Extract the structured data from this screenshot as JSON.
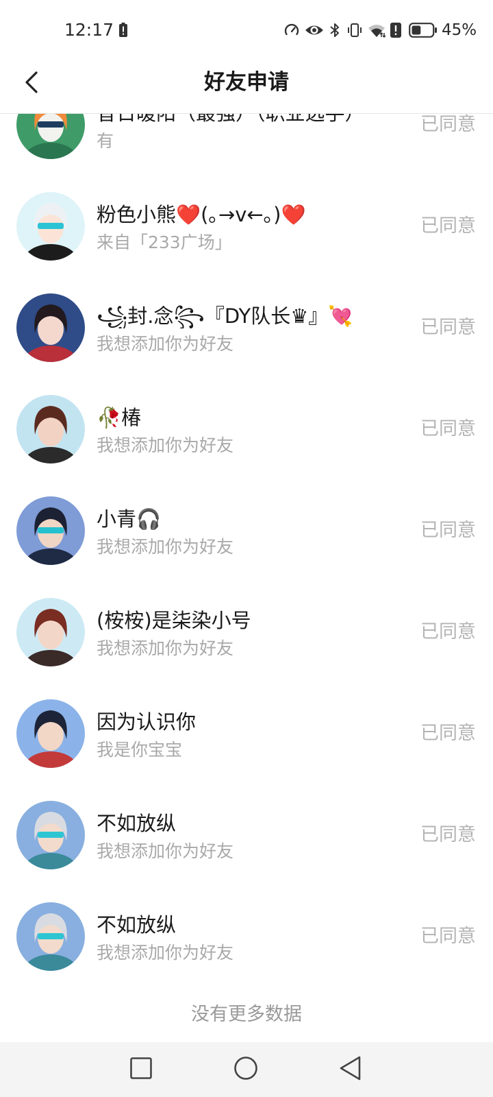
{
  "status_bar": {
    "time": "12:17",
    "battery_text": "45%",
    "battery_level": 0.45,
    "icons": [
      "battery-alert-icon",
      "speedometer-icon",
      "eye-icon",
      "bluetooth-icon",
      "vibrate-icon",
      "wifi-icon",
      "alert-icon",
      "battery-icon"
    ]
  },
  "header": {
    "back_icon": "back-arrow-icon",
    "title": "好友申请"
  },
  "requests": [
    {
      "name": "昔日暖阳（最强）（职业选手）",
      "message": "有",
      "status": "已同意",
      "avatar": {
        "bg": "#3f9c68",
        "hair": "#ef8b3b",
        "skin": "#f2f2ef",
        "outfit": "#2a7650",
        "accent": "#1f3d5e"
      }
    },
    {
      "name": "粉色小熊❤️(｡→v←｡)❤️",
      "message": "来自「233广场」",
      "status": "已同意",
      "avatar": {
        "bg": "#dff4f8",
        "hair": "#eef1f4",
        "skin": "#fbe4d7",
        "outfit": "#1c1c1c",
        "accent": "#2cc3d5"
      }
    },
    {
      "name": "꧁封.念꧂『DY队长♛』💘",
      "message": "我想添加你为好友",
      "status": "已同意",
      "avatar": {
        "bg": "#2f4c88",
        "hair": "#221a1f",
        "skin": "#f4d8ce",
        "outfit": "#b92f3a",
        "accent": "none"
      }
    },
    {
      "name": "🥀椿",
      "message": "我想添加你为好友",
      "status": "已同意",
      "avatar": {
        "bg": "#c2e4f1",
        "hair": "#5b2a1f",
        "skin": "#f2d3c3",
        "outfit": "#2b2b2b",
        "accent": "none"
      }
    },
    {
      "name": "小青🎧",
      "message": "我想添加你为好友",
      "status": "已同意",
      "avatar": {
        "bg": "#7f9cd7",
        "hair": "#1c2233",
        "skin": "#f0d6c5",
        "outfit": "#1f2a44",
        "accent": "#26c1cf"
      }
    },
    {
      "name": "(桉桉)是柒染小号",
      "message": "我想添加你为好友",
      "status": "已同意",
      "avatar": {
        "bg": "#cdeaf4",
        "hair": "#7a2d22",
        "skin": "#f2d7c9",
        "outfit": "#3a2a28",
        "accent": "none"
      }
    },
    {
      "name": "因为认识你",
      "message": "我是你宝宝",
      "status": "已同意",
      "avatar": {
        "bg": "#8bb3e9",
        "hair": "#1e2438",
        "skin": "#f2d7c7",
        "outfit": "#c33a3a",
        "accent": "none"
      }
    },
    {
      "name": "不如放纵",
      "message": "我想添加你为好友",
      "status": "已同意",
      "avatar": {
        "bg": "#88afdf",
        "hair": "#d8dce2",
        "skin": "#f2dbcc",
        "outfit": "#3a8a9a",
        "accent": "#2ec5d3"
      }
    },
    {
      "name": "不如放纵",
      "message": "我想添加你为好友",
      "status": "已同意",
      "avatar": {
        "bg": "#88afdf",
        "hair": "#d8dce2",
        "skin": "#f2dbcc",
        "outfit": "#3a8a9a",
        "accent": "#2ec5d3"
      }
    }
  ],
  "footer": {
    "end_text": "没有更多数据"
  },
  "nav_bar": {
    "icons": [
      "recent-apps-icon",
      "home-icon",
      "back-icon"
    ]
  },
  "colors": {
    "name_text": "#1a1a1a",
    "secondary_text": "#a9a9a9",
    "status_text": "#b4b4b4",
    "nav_background": "#f4f4f4"
  }
}
